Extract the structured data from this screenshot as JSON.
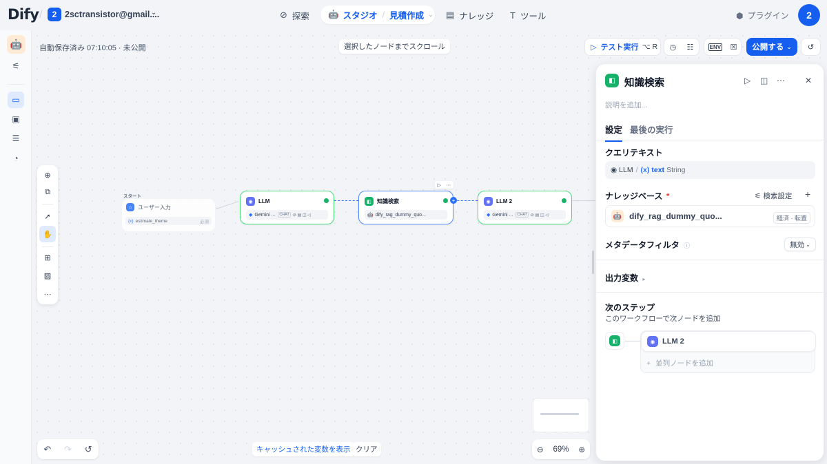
{
  "topbar": {
    "logo": "Dify",
    "workspace_badge": "2",
    "workspace_name": "2sctransistor@gmail....",
    "nav_explore": "探索",
    "nav_studio": "スタジオ",
    "nav_app": "見積作成",
    "nav_knowledge": "ナレッジ",
    "nav_tools": "ツール",
    "plugin": "プラグイン",
    "avatar": "2"
  },
  "toolbar": {
    "autosave": "自動保存済み 07:10:05 · 未公開",
    "scroll_to_selected": "選択したノードまでスクロール",
    "test_run": "テスト実行",
    "test_run_shortcut": "⌥ R",
    "env": "ENV",
    "publish": "公開する"
  },
  "nodes": {
    "start_header": "スタート",
    "start_title": "ユーザー入力",
    "start_var": "estimate_theme",
    "start_required": "必須",
    "llm1_title": "LLM",
    "llm1_model": "Gemini ...",
    "llm1_tag": "CHAT",
    "kr_title": "知識検索",
    "kr_dataset": "dify_rag_dummy_quo...",
    "llm2_title": "LLM 2",
    "llm2_model": "Gemini ...",
    "llm2_tag": "CHAT"
  },
  "panel": {
    "title": "知識検索",
    "description_placeholder": "説明を追加...",
    "tab_settings": "設定",
    "tab_last_run": "最後の実行",
    "query_label": "クエリテキスト",
    "query_node": "LLM",
    "query_var": "text",
    "query_type": "String",
    "kb_label": "ナレッジベース",
    "kb_required": "*",
    "retrieval_settings": "検索設定",
    "kb_name": "dify_rag_dummy_quo...",
    "kb_tag": "経済 · 転置",
    "metadata_filter": "メタデータフィルタ",
    "metadata_value": "無効",
    "output_vars": "出力変数",
    "next_step": "次のステップ",
    "next_step_desc": "このワークフローで次ノードを追加",
    "next_node": "LLM 2",
    "add_parallel": "並列ノードを追加"
  },
  "bottom": {
    "show_cached": "キャッシュされた変数を表示",
    "clear": "クリア",
    "zoom": "69%"
  },
  "colors": {
    "accent": "#155eef",
    "success": "#17b26a",
    "llm": "#6172f3"
  }
}
